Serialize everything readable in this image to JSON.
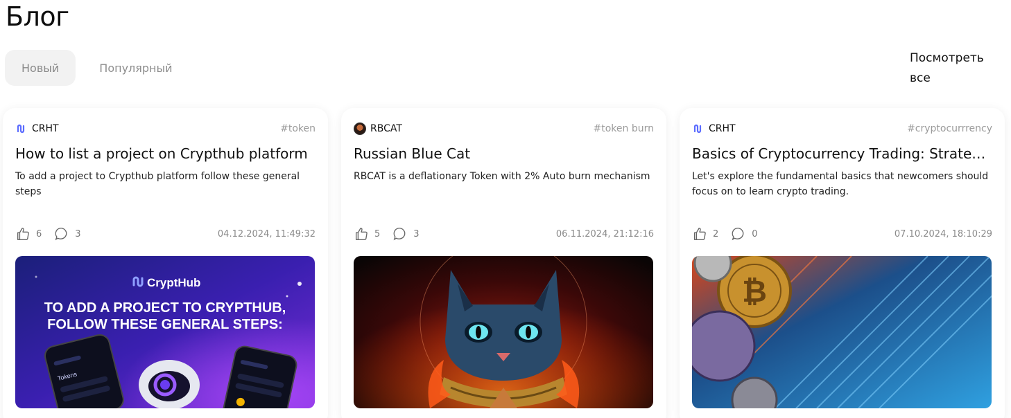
{
  "page": {
    "title": "Блог"
  },
  "tabs": [
    {
      "label": "Новый",
      "active": true
    },
    {
      "label": "Популярный",
      "active": false
    }
  ],
  "see_all": "Посмотреть все",
  "cards": [
    {
      "author": "CRHT",
      "tag": "#token",
      "title": "How to list a project on Crypthub platform",
      "description": "To add a project to Crypthub platform follow these general steps",
      "likes": "6",
      "comments": "3",
      "date": "04.12.2024, 11:49:32",
      "image": {
        "brand": "CryptHub",
        "headline_1": "TO ADD A PROJECT TO CRYPTHUB,",
        "headline_2": "FOLLOW THESE GENERAL STEPS:",
        "phone_label": "Tokens"
      }
    },
    {
      "author": "RBCAT",
      "tag": "#token burn",
      "title": "Russian Blue Cat",
      "description": "RBCAT is a deflationary Token with 2% Auto burn mechanism",
      "likes": "5",
      "comments": "3",
      "date": "06.11.2024, 21:12:16"
    },
    {
      "author": "CRHT",
      "tag": "#cryptocurrrency",
      "title": "Basics of Cryptocurrency Trading: Strategies",
      "description": "Let's explore the fundamental basics that newcomers should focus on to learn crypto trading.",
      "likes": "2",
      "comments": "0",
      "date": "07.10.2024, 18:10:29"
    }
  ],
  "colors": {
    "brand_accent": "#6b4cff",
    "muted": "#8a8a8a",
    "card_bg": "#ffffff",
    "tab_active_bg": "#f2f2f2"
  },
  "icons": {
    "like": "thumbs-up-icon",
    "comment": "comment-bubble-icon",
    "crht_logo": "crypthub-logo-icon"
  }
}
